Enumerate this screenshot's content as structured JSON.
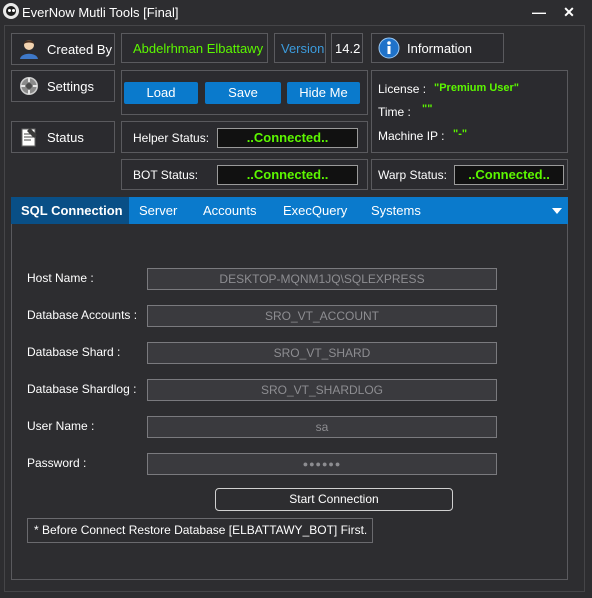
{
  "window": {
    "title": "EverNow Mutli Tools [Final]",
    "minimize_glyph": "—",
    "close_glyph": "✕"
  },
  "sidebar": {
    "created_by_label": "Created By",
    "settings_label": "Settings",
    "status_label": "Status"
  },
  "header": {
    "author_name": "Abdelrhman Elbattawy",
    "version_label": "Version",
    "version_value": "14.2",
    "information_label": "Information"
  },
  "actions": {
    "load_label": "Load",
    "save_label": "Save",
    "hide_label": "Hide Me"
  },
  "license_info": {
    "license_label": "License :",
    "license_value": "\"Premium User\"",
    "time_label": "Time :",
    "time_value": "\"\"",
    "machine_ip_label": "Machine IP :",
    "machine_ip_value": "\"-\""
  },
  "statuses": {
    "helper_label": "Helper Status:",
    "helper_value": "..Connected..",
    "bot_label": "BOT Status:",
    "bot_value": "..Connected..",
    "warp_label": "Warp Status:",
    "warp_value": "..Connected.."
  },
  "tabs": [
    {
      "label": "SQL Connection"
    },
    {
      "label": "Server"
    },
    {
      "label": "Accounts"
    },
    {
      "label": "ExecQuery"
    },
    {
      "label": "Systems"
    }
  ],
  "sql_form": {
    "host_name_label": "Host Name :",
    "host_name_value": "DESKTOP-MQNM1JQ\\SQLEXPRESS",
    "db_accounts_label": "Database Accounts :",
    "db_accounts_value": "SRO_VT_ACCOUNT",
    "db_shard_label": "Database Shard :",
    "db_shard_value": "SRO_VT_SHARD",
    "db_shardlog_label": "Database Shardlog :",
    "db_shardlog_value": "SRO_VT_SHARDLOG",
    "user_name_label": "User Name :",
    "user_name_value": "sa",
    "password_label": "Password :",
    "password_value": "●●●●●●",
    "start_button_label": "Start Connection",
    "note": "* Before Connect Restore Database [ELBATTAWY_BOT] First."
  },
  "colors": {
    "accent_blue": "#0a7acc",
    "active_tab": "#094f86",
    "connected_green": "#5cf700",
    "author_green": "#5cf700",
    "version_blue": "#3c9bdc"
  },
  "icons": {
    "app": "panda-icon",
    "created_by": "user-icon",
    "settings": "gear-icon",
    "status": "clipboard-icon",
    "information": "info-icon",
    "tab_dropdown": "caret-down-icon"
  }
}
